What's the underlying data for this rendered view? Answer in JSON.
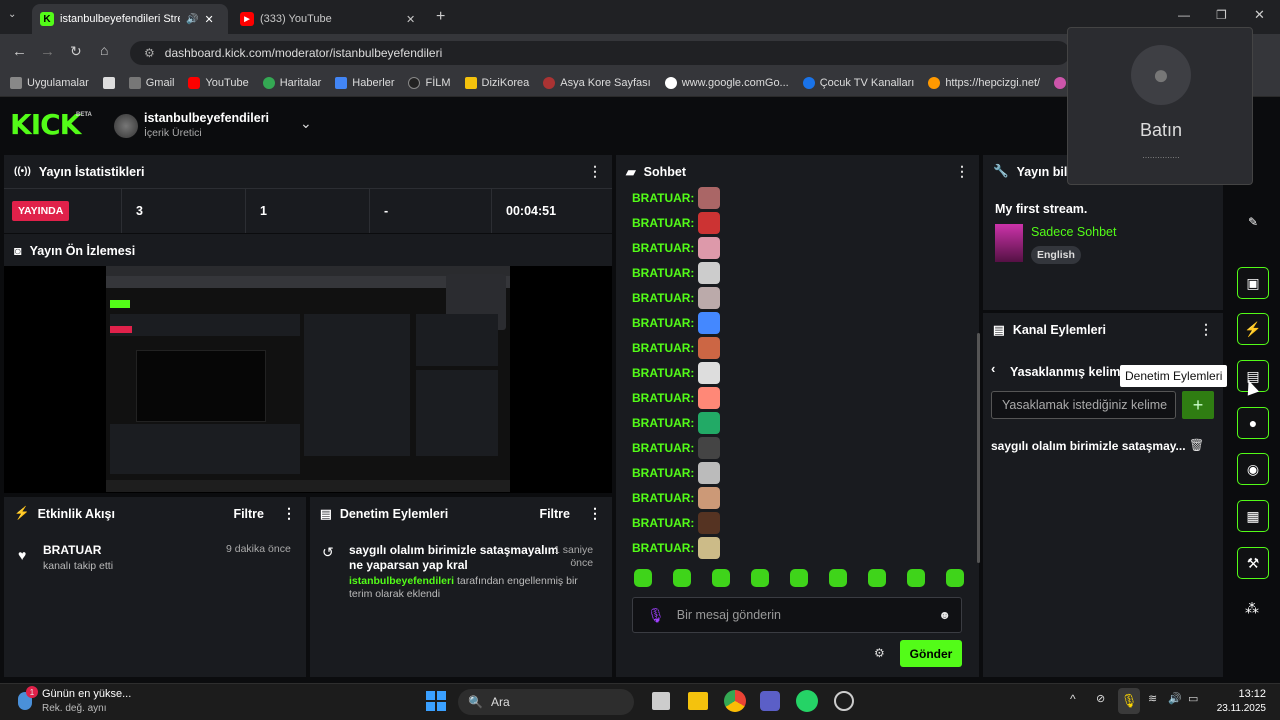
{
  "browser": {
    "tabs": [
      {
        "label": "istanbulbeyefendileri Stream",
        "active": true
      },
      {
        "label": "(333) YouTube",
        "active": false
      }
    ],
    "url": "dashboard.kick.com/moderator/istanbulbeyefendileri",
    "bookmarks": [
      "Uygulamalar",
      "Gmail",
      "YouTube",
      "Haritalar",
      "Haberler",
      "FİLM",
      "DiziKorea",
      "Asya Kore Sayfası",
      "www.google.comGo...",
      "Çocuk TV Kanalları",
      "https://hepcizgi.net/",
      "http"
    ]
  },
  "header": {
    "beta": "BETA",
    "channel_name": "istanbulbeyefendileri",
    "channel_role": "İçerik Üretici"
  },
  "stats": {
    "title": "Yayın İstatistikleri",
    "live_badge": "YAYINDA",
    "values": [
      "3",
      "1",
      "-",
      "00:04:51"
    ]
  },
  "preview": {
    "title": "Yayın Ön İzlemesi"
  },
  "activity": {
    "title": "Etkinlik Akışı",
    "filter": "Filtre",
    "user": "BRATUAR",
    "action": "kanalı takip etti",
    "time": "9 dakika önce"
  },
  "mod_actions": {
    "title": "Denetim Eylemleri",
    "filter": "Filtre",
    "phrase_line1": "saygılı olalım birimizle sataşmayalım",
    "phrase_line2": "ne yaparsan yap kral",
    "time_line1": "1 saniye",
    "time_line2": "önce",
    "actor": "istanbulbeyefendileri",
    "desc_part1": " tarafından engellenmiş bir",
    "desc_part2": "terim olarak eklendi"
  },
  "chat": {
    "title": "Sohbet",
    "username": "BRATUAR:",
    "message_count": 15,
    "placeholder": "Bir mesaj gönderin",
    "send": "Gönder"
  },
  "stream_info": {
    "title": "Yayın bilgi",
    "stream_title": "My first stream.",
    "category": "Sadece Sohbet",
    "language": "English"
  },
  "channel_actions": {
    "title": "Kanal Eylemleri",
    "subtitle": "Yasaklanmış kelime",
    "input_placeholder": "Yasaklamak istediğiniz kelime",
    "banned_word": "saygılı olalım birimizle sataşmay...",
    "tooltip": "Denetim Eylemleri"
  },
  "popup": {
    "name": "Batın",
    "subtext": "..............."
  },
  "taskbar": {
    "weather_line1": "Günün en yükse...",
    "weather_line2": "Rek. değ. aynı",
    "search": "Ara",
    "time": "13:12",
    "date": "23.11.2025"
  },
  "colors": {
    "accent": "#53fc18",
    "live": "#e0214a",
    "panel": "#191b1f"
  }
}
